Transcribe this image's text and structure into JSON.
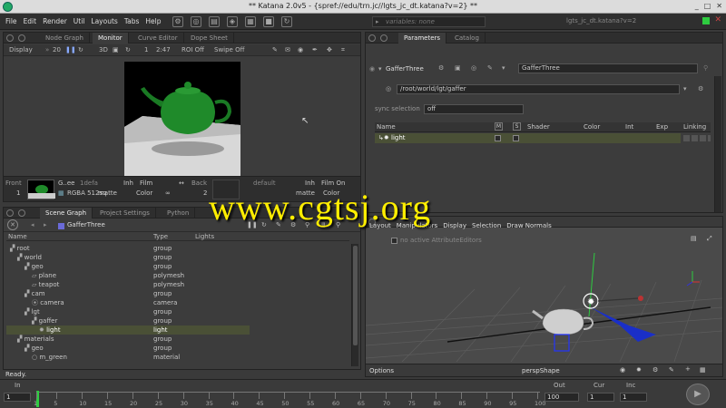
{
  "window": {
    "title": "** Katana 2.0v5 - {spref://edu/trn.jc//lgts_jc_dt.katana?v=2} **",
    "buttons": [
      "_",
      "□",
      "✕"
    ]
  },
  "menubar": {
    "items": [
      "File",
      "Edit",
      "Render",
      "Util",
      "Layouts",
      "Tabs",
      "Help"
    ],
    "variables": "variables: none",
    "file_field": "lgts_jc_dt.katana?v=2"
  },
  "viewer": {
    "tabs": [
      "Node Graph",
      "Monitor",
      "Curve Editor",
      "Dope Sheet"
    ],
    "active_tab": "Monitor",
    "toolbar": {
      "display": "Display",
      "zoom": "20",
      "mode": "3D",
      "frame": "1",
      "ratio": "2:47",
      "roi": "ROI Off",
      "swipe": "Swipe Off"
    },
    "thumbstrip": {
      "front_label": "Front",
      "front_num": "1",
      "name": "G..ee",
      "default1": "1defa",
      "rgba": "RGBA 512sq",
      "matte": "matte",
      "inh1": "Inh",
      "film1": "Film",
      "color1": "Color",
      "back_label": "Back",
      "back_num": "2",
      "default2": "default",
      "inh2": "Inh",
      "film2": "Film On",
      "matte2": "matte",
      "color2": "Color"
    }
  },
  "scene_graph": {
    "tabs": [
      "Scene Graph",
      "Project Settings",
      "Python"
    ],
    "node_name": "GafferThree",
    "columns": [
      "Name",
      "Type",
      "Lights"
    ],
    "rows": [
      {
        "name": "root",
        "type": "group",
        "indent": 0,
        "icon": "group-icon"
      },
      {
        "name": "world",
        "type": "group",
        "indent": 1,
        "icon": "group-icon"
      },
      {
        "name": "geo",
        "type": "group",
        "indent": 2,
        "icon": "group-icon"
      },
      {
        "name": "plane",
        "type": "polymesh",
        "indent": 3,
        "icon": "mesh-icon"
      },
      {
        "name": "teapot",
        "type": "polymesh",
        "indent": 3,
        "icon": "mesh-icon"
      },
      {
        "name": "cam",
        "type": "group",
        "indent": 2,
        "icon": "group-icon"
      },
      {
        "name": "camera",
        "type": "camera",
        "indent": 3,
        "icon": "camera-icon"
      },
      {
        "name": "lgt",
        "type": "group",
        "indent": 2,
        "icon": "group-icon"
      },
      {
        "name": "gaffer",
        "type": "group",
        "indent": 3,
        "icon": "group-icon"
      },
      {
        "name": "light",
        "type": "light",
        "indent": 4,
        "icon": "light-icon",
        "selected": true
      },
      {
        "name": "materials",
        "type": "group",
        "indent": 1,
        "icon": "group-icon"
      },
      {
        "name": "geo",
        "type": "group",
        "indent": 2,
        "icon": "group-icon"
      },
      {
        "name": "m_green",
        "type": "material",
        "indent": 3,
        "icon": "material-icon"
      }
    ],
    "status": "Ready."
  },
  "parameters": {
    "tabs": [
      "Parameters",
      "Catalog"
    ],
    "node_name": "GafferThree",
    "root_location": "/root/world/lgt/gaffer",
    "sync_label": "sync selection",
    "sync_value": "off",
    "columns": [
      "Name",
      "M",
      "S",
      "Shader",
      "Color",
      "Int",
      "Exp",
      "Linking"
    ],
    "rows": [
      {
        "name": "light"
      }
    ]
  },
  "viewer3d": {
    "menu": [
      "Layout",
      "Manipulators",
      "Display",
      "Selection",
      "Draw Normals"
    ],
    "no_editors": "no active AttributeEditors",
    "options": "Options",
    "camera": "perspShape"
  },
  "timeline": {
    "in_label": "In",
    "in_value": "1",
    "out_label": "Out",
    "out_value": "100",
    "cur_label": "Cur",
    "cur_value": "1",
    "inc_label": "Inc",
    "inc_value": "1",
    "ticks": [
      "1",
      "5",
      "10",
      "15",
      "20",
      "25",
      "30",
      "35",
      "40",
      "45",
      "50",
      "55",
      "60",
      "65",
      "70",
      "75",
      "80",
      "85",
      "90",
      "95",
      "100"
    ]
  },
  "watermark": "www.cgtsj.org",
  "colors": {
    "selection": "#4a5036",
    "teapot": "#1f8a2a",
    "accent_green": "#2ecc40"
  }
}
